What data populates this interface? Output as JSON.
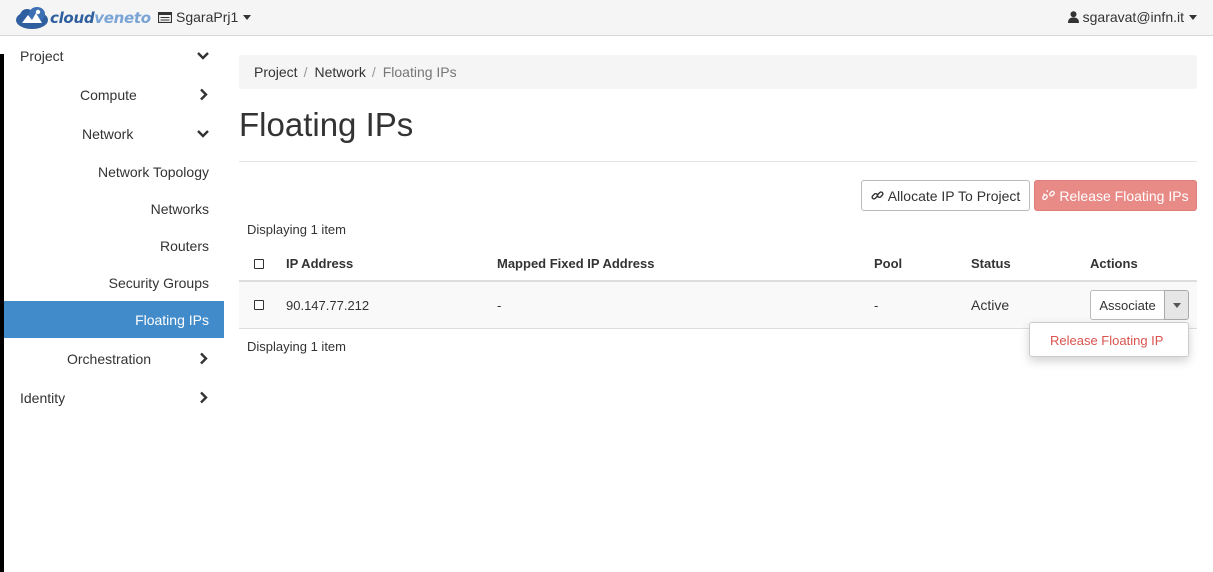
{
  "brand": {
    "name_bold": "cloud",
    "name_light": "veneto",
    "icon": "cloudveneto-logo"
  },
  "topbar": {
    "project": {
      "label": "SgaraPrj1",
      "icon": "project-list-icon"
    },
    "user": {
      "label": "sgaravat@infn.it",
      "icon": "user-icon"
    }
  },
  "sidebar": {
    "items": [
      {
        "label": "Project",
        "chevron": "down"
      },
      {
        "label": "Compute",
        "chevron": "right"
      },
      {
        "label": "Network",
        "chevron": "down"
      },
      {
        "label": "Network Topology"
      },
      {
        "label": "Networks"
      },
      {
        "label": "Routers"
      },
      {
        "label": "Security Groups"
      },
      {
        "label": "Floating IPs",
        "active": true
      },
      {
        "label": "Orchestration",
        "chevron": "right"
      },
      {
        "label": "Identity",
        "chevron": "right"
      }
    ]
  },
  "breadcrumb": {
    "items": [
      "Project",
      "Network",
      "Floating IPs"
    ],
    "separator": "/"
  },
  "page": {
    "title": "Floating IPs"
  },
  "actions": {
    "allocate": "Allocate IP To Project",
    "release": "Release Floating IPs"
  },
  "table": {
    "count_text_top": "Displaying 1 item",
    "count_text_bottom": "Displaying 1 item",
    "columns": [
      "IP Address",
      "Mapped Fixed IP Address",
      "Pool",
      "Status",
      "Actions"
    ],
    "rows": [
      {
        "ip": "90.147.77.212",
        "mapped": "-",
        "pool": "-",
        "status": "Active",
        "action": "Associate"
      }
    ]
  },
  "row_menu": {
    "items": [
      "Release Floating IP"
    ]
  },
  "colors": {
    "accent": "#428bca",
    "danger": "#d9534f",
    "danger_disabled": "#e88a86",
    "brand": "#2f5f9e"
  }
}
